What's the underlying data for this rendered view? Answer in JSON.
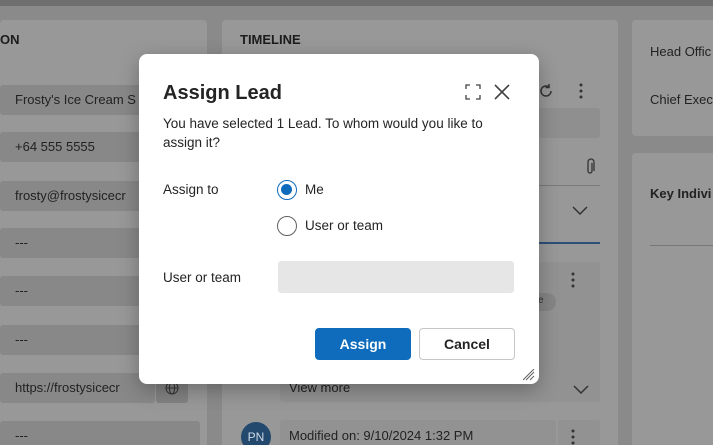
{
  "background": {
    "left_section_title": "ON",
    "fields": [
      {
        "value": "Frosty's Ice Cream S"
      },
      {
        "value": "+64 555 5555"
      },
      {
        "value": "frosty@frostysicecr"
      },
      {
        "value": "---"
      },
      {
        "value": "---"
      },
      {
        "value": "---"
      },
      {
        "value": "https://frostysicecr"
      },
      {
        "value": "---"
      }
    ],
    "timeline_title": "TIMELINE",
    "timeline_view_more": "View more",
    "timeline_modified": "Modified on: 9/10/2024 1:32 PM",
    "timeline_chip": "e",
    "avatar_initials": "PN",
    "right_labels": [
      "Head Offic",
      "Chief Exec",
      "Key Indivi"
    ]
  },
  "dialog": {
    "title": "Assign Lead",
    "description": "You have selected 1 Lead. To whom would you like to assign it?",
    "assign_to_label": "Assign to",
    "options": [
      {
        "label": "Me",
        "checked": true
      },
      {
        "label": "User or team",
        "checked": false
      }
    ],
    "user_or_team_label": "User or team",
    "user_or_team_value": "",
    "assign_button": "Assign",
    "cancel_button": "Cancel"
  },
  "colors": {
    "primary": "#0f6cbd",
    "overlay": "#8a8a8a"
  }
}
